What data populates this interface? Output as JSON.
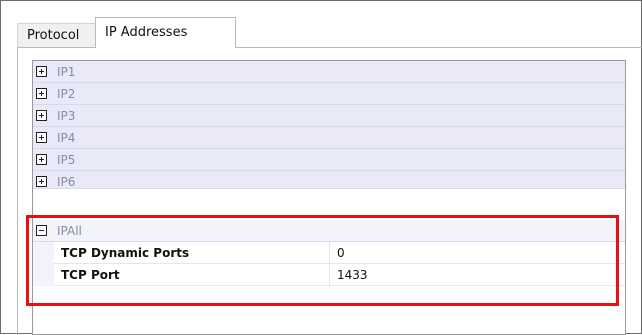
{
  "tabs": [
    {
      "label": "Protocol"
    },
    {
      "label": "IP Addresses"
    }
  ],
  "categories": [
    {
      "label": "IP1"
    },
    {
      "label": "IP2"
    },
    {
      "label": "IP3"
    },
    {
      "label": "IP4"
    },
    {
      "label": "IP5"
    },
    {
      "label": "IP6"
    }
  ],
  "ipall": {
    "label": "IPAll",
    "properties": [
      {
        "name": "TCP Dynamic Ports",
        "value": "0"
      },
      {
        "name": "TCP Port",
        "value": "1433"
      }
    ]
  },
  "colors": {
    "highlight": "#e8100e",
    "category_bg": "#e9e9f7",
    "category_text": "#8a8aa8"
  },
  "icons": {
    "collapsed": "plus-box-icon",
    "expanded": "minus-box-icon"
  }
}
